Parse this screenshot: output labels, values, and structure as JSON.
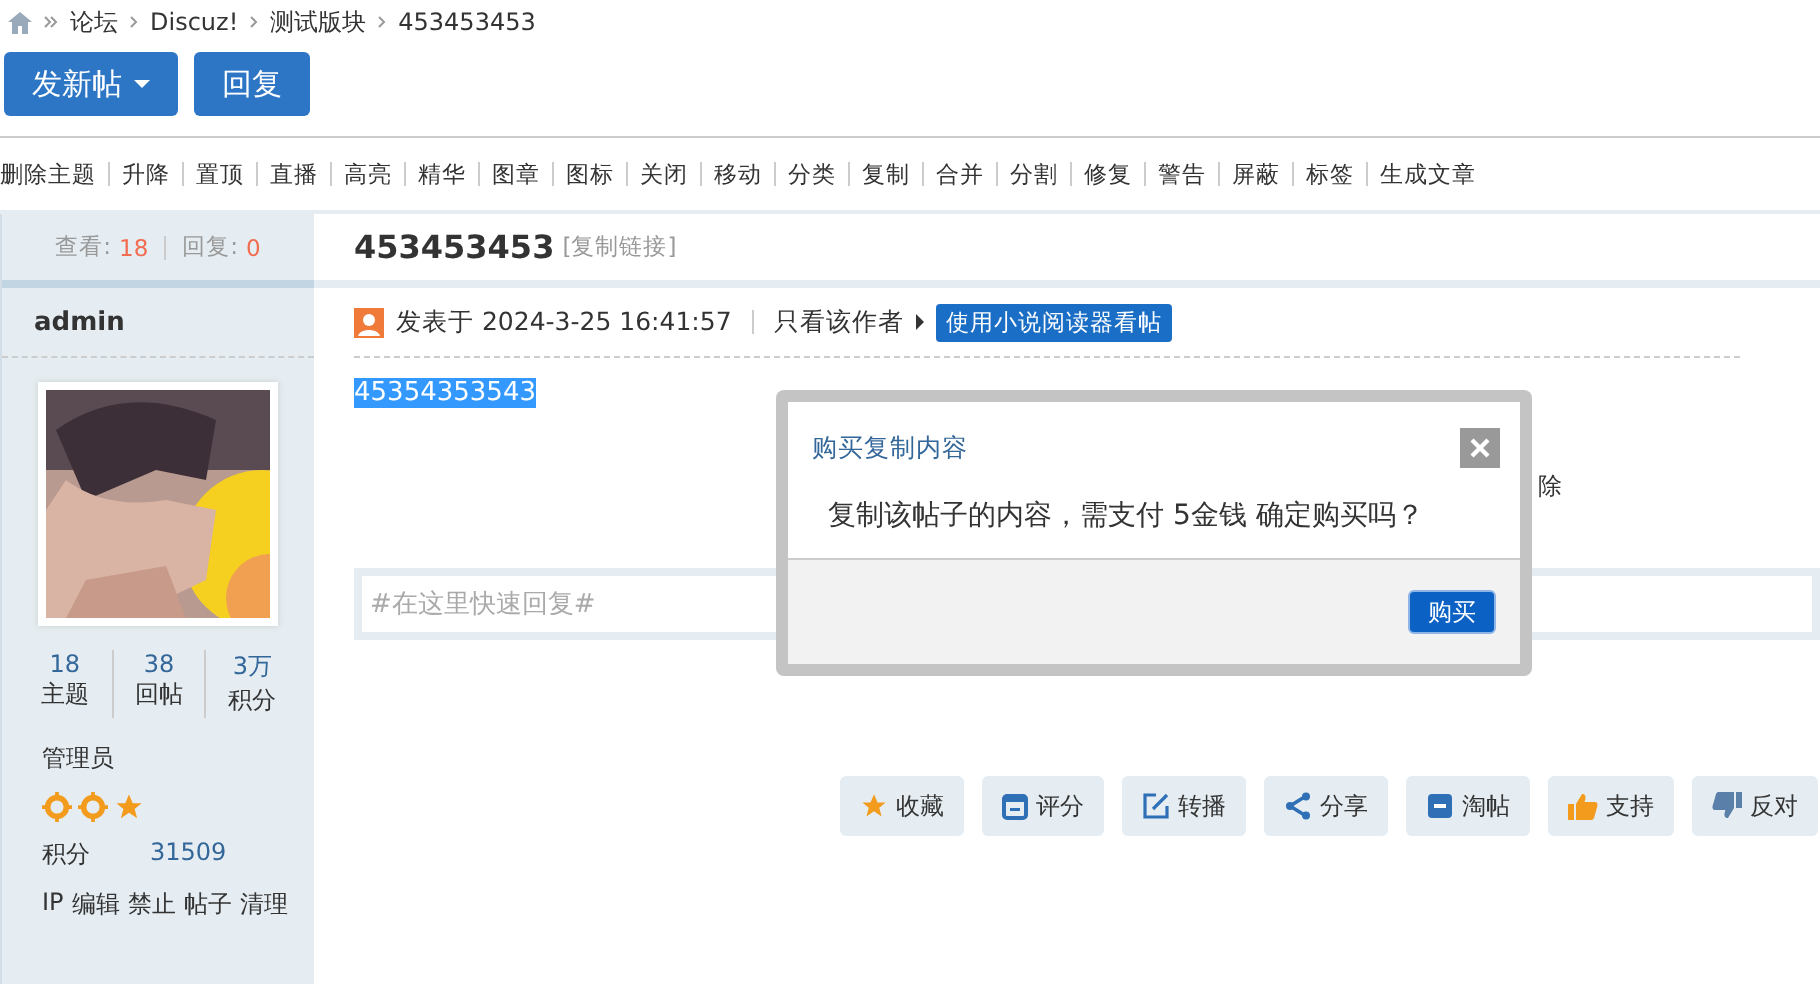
{
  "breadcrumb": [
    "论坛",
    "Discuz!",
    "测试版块",
    "453453453"
  ],
  "buttons": [
    {
      "label": "发新帖",
      "kind": "dropdown"
    },
    {
      "label": "回复",
      "kind": "plain"
    }
  ],
  "mod_actions": [
    "删除主题",
    "升降",
    "置顶",
    "直播",
    "高亮",
    "精华",
    "图章",
    "图标",
    "关闭",
    "移动",
    "分类",
    "复制",
    "合并",
    "分割",
    "修复",
    "警告",
    "屏蔽",
    "标签",
    "生成文章"
  ],
  "thread_stats": {
    "views_label": "查看:",
    "views": "18",
    "replies_label": "回复:",
    "replies": "0"
  },
  "thread": {
    "title": "453453453",
    "copy_link": "[复制链接]"
  },
  "author": {
    "name": "admin",
    "stats": [
      {
        "value": "18",
        "label": "主题"
      },
      {
        "value": "38",
        "label": "回帖"
      },
      {
        "value": "3万",
        "label": "积分"
      }
    ],
    "group": "管理员",
    "points_label": "积分",
    "points": "31509",
    "admin_links": [
      "IP",
      "编辑",
      "禁止",
      "帖子",
      "清理"
    ]
  },
  "post": {
    "posted": "发表于 2024-3-25 16:41:57",
    "only_author": "只看该作者",
    "reader_button": "使用小说阅读器看帖",
    "content": "45354353543",
    "hidden_fragment": "除"
  },
  "quick_reply": {
    "placeholder": "#在这里快速回复#"
  },
  "post_actions": [
    {
      "label": "收藏",
      "kind": "star"
    },
    {
      "label": "评分",
      "kind": "calendar"
    },
    {
      "label": "转播",
      "kind": "edit"
    },
    {
      "label": "分享",
      "kind": "share"
    },
    {
      "label": "淘帖",
      "kind": "box"
    },
    {
      "label": "支持",
      "kind": "up"
    },
    {
      "label": "反对",
      "kind": "down"
    }
  ],
  "dialog": {
    "title": "购买复制内容",
    "message": "复制该帖子的内容，需支付 5金钱 确定购买吗？",
    "confirm": "购买"
  }
}
